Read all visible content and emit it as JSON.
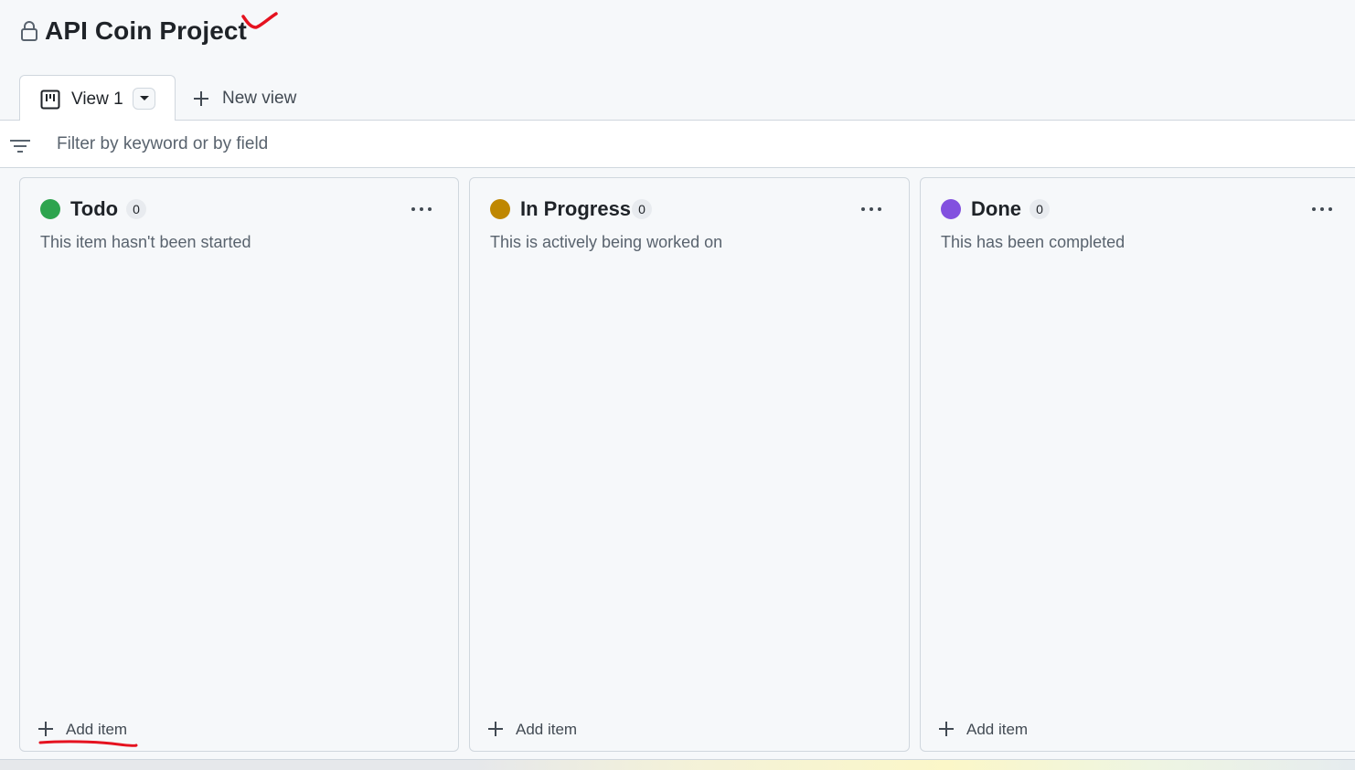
{
  "project": {
    "title": "API Coin Project",
    "lock_icon": "lock-icon",
    "annotation_mark": "red-checkmark"
  },
  "views": {
    "active_tab": {
      "label": "View 1",
      "icon": "board-icon"
    },
    "new_view_label": "New view"
  },
  "filter": {
    "placeholder": "Filter by keyword or by field",
    "value": ""
  },
  "columns": [
    {
      "name": "Todo",
      "count": "0",
      "description": "This item hasn't been started",
      "color": "#2da44e",
      "add_label": "Add item"
    },
    {
      "name": "In Progress",
      "count": "0",
      "description": "This is actively being worked on",
      "color": "#bf8700",
      "add_label": "Add item"
    },
    {
      "name": "Done",
      "count": "0",
      "description": "This has been completed",
      "color": "#8250df",
      "add_label": "Add item"
    }
  ],
  "colors": {
    "background": "#f6f8fa",
    "border": "#d0d7de",
    "annotation_red": "#e5121f"
  }
}
